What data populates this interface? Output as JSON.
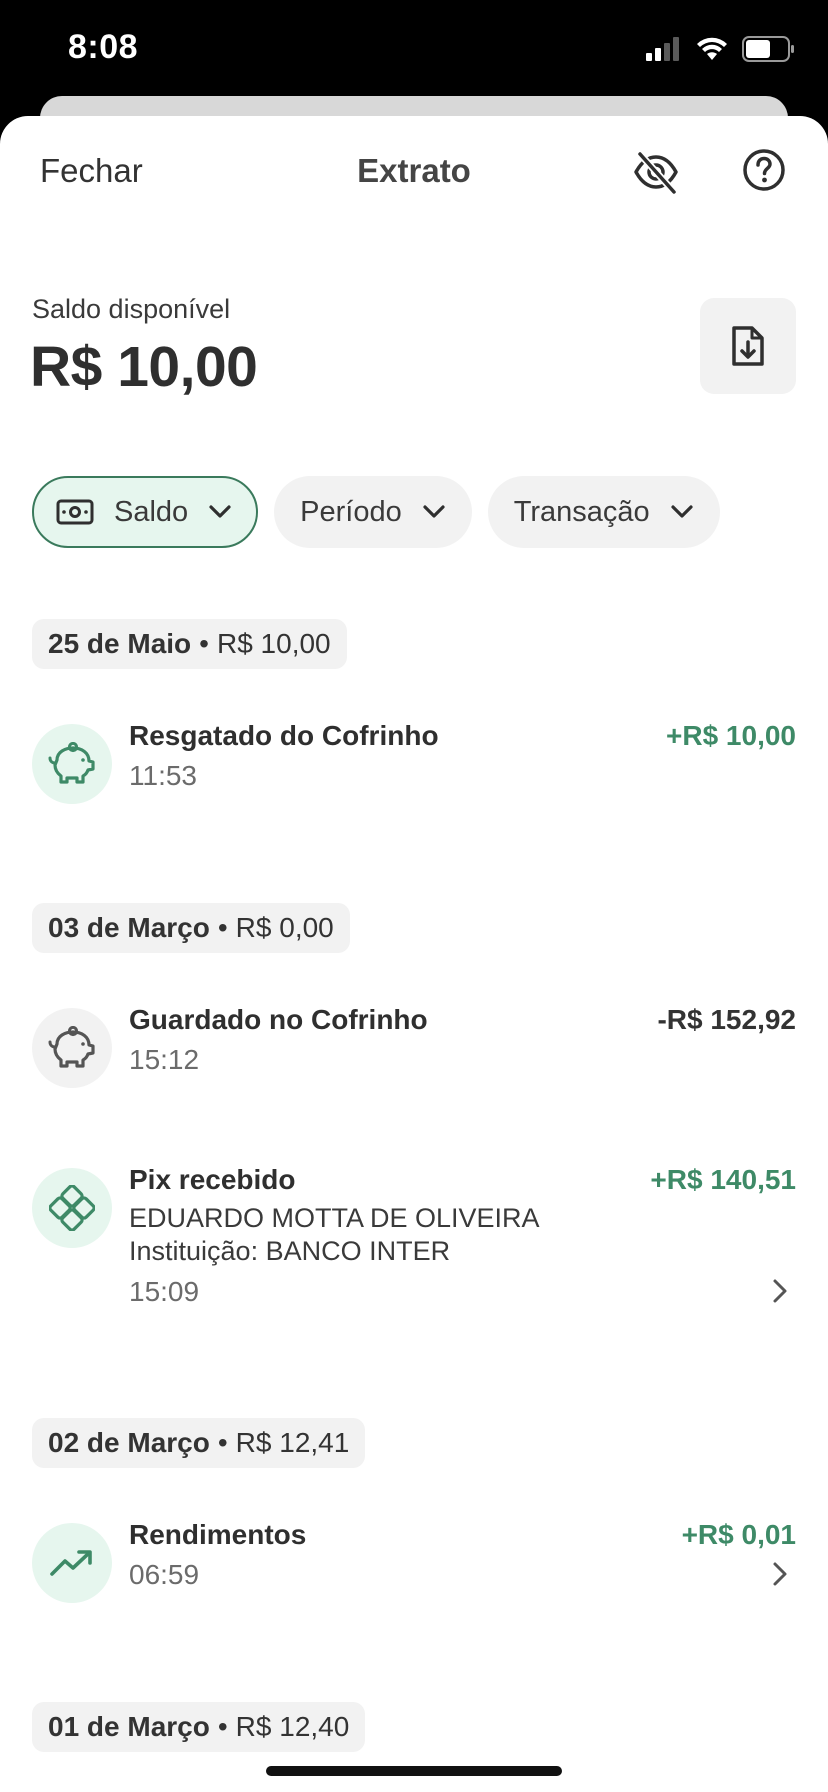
{
  "status_bar": {
    "time": "8:08"
  },
  "header": {
    "close_label": "Fechar",
    "title": "Extrato",
    "hide_values_icon": "eye-off-icon",
    "help_icon": "help-circle-icon"
  },
  "balance": {
    "label": "Saldo disponível",
    "value": "R$ 10,00",
    "export_icon": "file-download-icon"
  },
  "filters": [
    {
      "label": "Saldo",
      "icon": "money-icon",
      "active": true
    },
    {
      "label": "Período",
      "active": false
    },
    {
      "label": "Transação",
      "active": false
    }
  ],
  "groups": [
    {
      "date": "25 de Maio",
      "separator": "•",
      "balance": "R$ 10,00",
      "transactions": [
        {
          "title": "Resgatado do Cofrinho",
          "time": "11:53",
          "amount": "+R$ 10,00",
          "icon": "piggy-bank-icon"
        }
      ]
    },
    {
      "date": "03 de Março",
      "separator": "•",
      "balance": "R$ 0,00",
      "transactions": [
        {
          "title": "Guardado no Cofrinho",
          "time": "15:12",
          "amount": "-R$ 152,92",
          "icon": "piggy-bank-icon"
        },
        {
          "title": "Pix recebido",
          "line1": "EDUARDO MOTTA DE OLIVEIRA",
          "line2": "Instituição: BANCO INTER",
          "time": "15:09",
          "amount": "+R$ 140,51",
          "icon": "pix-icon"
        }
      ]
    },
    {
      "date": "02 de Março",
      "separator": "•",
      "balance": "R$ 12,41",
      "transactions": [
        {
          "title": "Rendimentos",
          "time": "06:59",
          "amount": "+R$ 0,01",
          "icon": "trending-up-icon"
        }
      ]
    },
    {
      "date": "01 de Março",
      "separator": "•",
      "balance": "R$ 12,40",
      "transactions": []
    }
  ],
  "colors": {
    "positive": "#3e8a67",
    "accent_bg": "#e6f6ee",
    "accent_border": "#3a7a5c"
  }
}
